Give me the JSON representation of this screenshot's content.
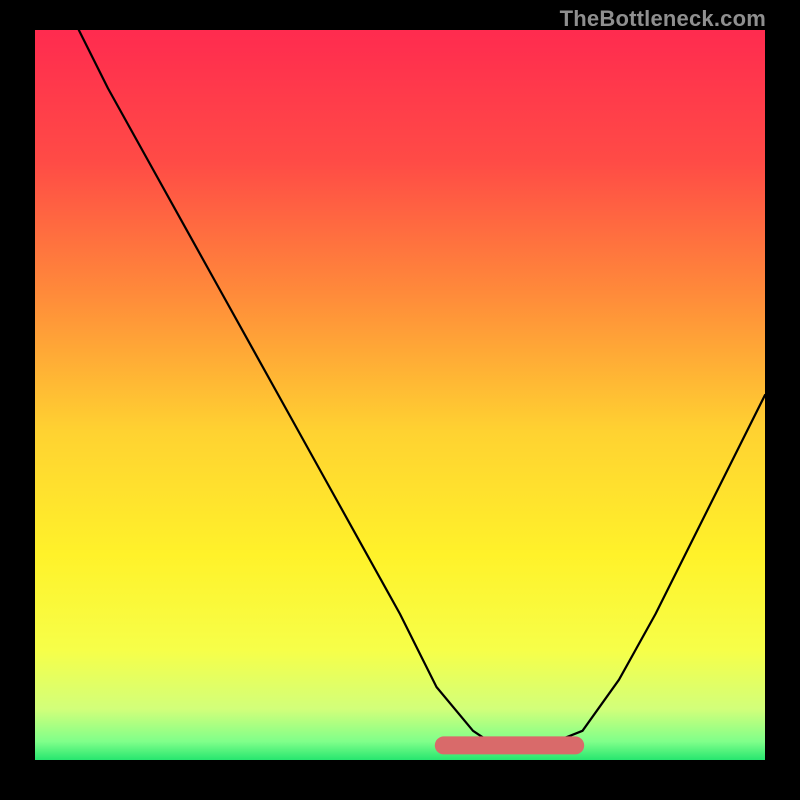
{
  "watermark": "TheBottleneck.com",
  "chart_data": {
    "type": "line",
    "title": "",
    "xlabel": "",
    "ylabel": "",
    "xlim": [
      0,
      100
    ],
    "ylim": [
      0,
      100
    ],
    "series": [
      {
        "name": "bottleneck-curve",
        "x": [
          6,
          10,
          15,
          20,
          25,
          30,
          35,
          40,
          45,
          50,
          52,
          55,
          60,
          63,
          65,
          70,
          75,
          80,
          85,
          90,
          95,
          100
        ],
        "y": [
          100,
          92,
          83,
          74,
          65,
          56,
          47,
          38,
          29,
          20,
          16,
          10,
          4,
          2,
          2,
          2,
          4,
          11,
          20,
          30,
          40,
          50
        ]
      }
    ],
    "highlight": {
      "name": "flat-bottom-highlight",
      "x_start": 56,
      "x_end": 74,
      "y": 2,
      "color": "#d96a6a"
    },
    "background": {
      "type": "vertical-gradient",
      "stops": [
        {
          "offset": 0.0,
          "color": "#ff2b4f"
        },
        {
          "offset": 0.18,
          "color": "#ff4b46"
        },
        {
          "offset": 0.36,
          "color": "#ff8a3a"
        },
        {
          "offset": 0.55,
          "color": "#ffd231"
        },
        {
          "offset": 0.72,
          "color": "#fff22a"
        },
        {
          "offset": 0.85,
          "color": "#f6ff49"
        },
        {
          "offset": 0.93,
          "color": "#d2ff7a"
        },
        {
          "offset": 0.975,
          "color": "#7fff8a"
        },
        {
          "offset": 1.0,
          "color": "#27e66f"
        }
      ]
    }
  }
}
